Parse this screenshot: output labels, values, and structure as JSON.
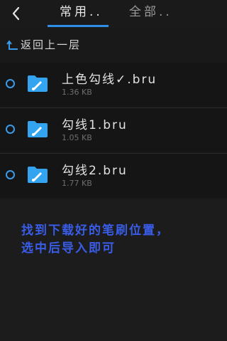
{
  "header": {
    "back_icon": "chevron-left-icon",
    "tabs": [
      {
        "label": "常用..",
        "active": true
      },
      {
        "label": "全部..",
        "active": false
      }
    ],
    "accent_color": "#2f8ee8"
  },
  "navigation": {
    "parent_label": "返回上一层",
    "parent_icon": "arrow-up-return-icon"
  },
  "files": [
    {
      "name": "上色勾线✓.bru",
      "size": "1.36 KB",
      "icon": "folder-brush-icon"
    },
    {
      "name": "勾线1.bru",
      "size": "1.05 KB",
      "icon": "folder-brush-icon"
    },
    {
      "name": "勾线2.bru",
      "size": "1.77 KB",
      "icon": "folder-brush-icon"
    }
  ],
  "hint": {
    "line1": "找到下载好的笔刷位置，",
    "line2": "选中后导入即可",
    "color": "#3a5de8"
  }
}
